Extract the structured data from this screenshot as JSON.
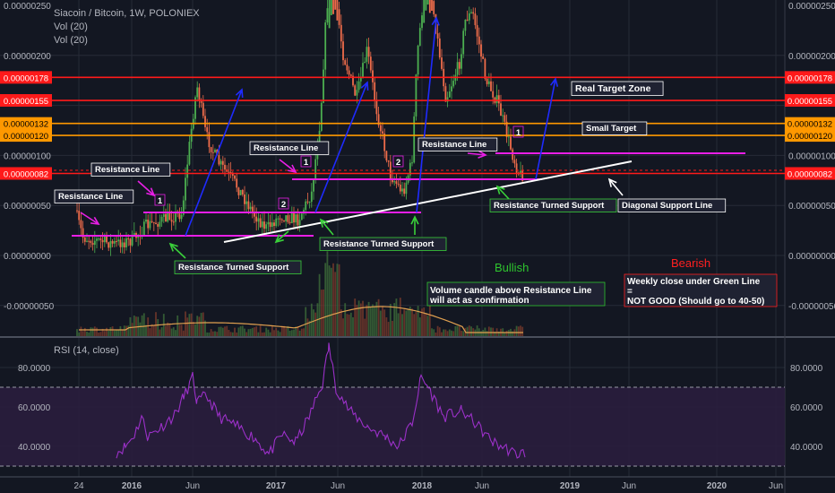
{
  "header": {
    "symbol": "Siacoin / Bitcoin, 1W, POLONIEX",
    "vol1": "Vol (20)",
    "vol2": "Vol (20)",
    "rsi_label": "RSI (14, close)"
  },
  "colors": {
    "background": "#131722",
    "grid": "#262b37",
    "up": "#4caf50",
    "down": "#ef6c4a",
    "red_line": "#ff1a1a",
    "orange_line": "#ff9800",
    "magenta": "#e91ee6",
    "white_line": "#ffffff",
    "blue_arrow": "#1f2bff",
    "green_arrow": "#3ad03a",
    "rsi_line": "#9b30c8",
    "rsi_band": "#2a1d3d"
  },
  "chart_data": [
    {
      "type": "candlestick",
      "title": "Siacoin / Bitcoin, 1W, POLONIEX",
      "ylim": [
        -8.5e-07,
        2.5e-06
      ],
      "y_ticks": [
        "0.00000250",
        "0.00000200",
        "0.00000100",
        "0.00000050",
        "0.00000000",
        "-0.00000050"
      ],
      "x_ticks": [
        "24",
        "2016",
        "Jun",
        "2017",
        "Jun",
        "2018",
        "Jun",
        "2019",
        "Jun",
        "2020",
        "Jun"
      ],
      "price_levels": [
        {
          "value": 1.78e-06,
          "label": "0.00000178",
          "color": "#ff1a1a"
        },
        {
          "value": 1.55e-06,
          "label": "0.00000155",
          "color": "#ff1a1a"
        },
        {
          "value": 1.32e-06,
          "label": "0.00000132",
          "color": "#ff9800"
        },
        {
          "value": 1.2e-06,
          "label": "0.00000120",
          "color": "#ff9800"
        },
        {
          "value": 8.2e-07,
          "label": "0.00000082",
          "color": "#ff1a1a"
        }
      ],
      "annotations": [
        "Resistance Line",
        "Resistance Line",
        "Resistance Line",
        "Resistance Line",
        "Resistance Line",
        "Resistance Turned Support",
        "Resistance Turned Support",
        "Resistance Turned Support",
        "Real Target Zone",
        "Small Target",
        "Diagonal Support Line",
        "Bullish",
        "Bearish",
        "Volume candle above Resistance Line will act as confirmation",
        "Weekly close under Green Line = NOT GOOD (Should go to 40-50)",
        "1",
        "2",
        "1",
        "2",
        "1",
        "1"
      ],
      "legend": [
        "Vol (20)",
        "Vol (20)"
      ]
    },
    {
      "type": "line",
      "title": "RSI (14, close)",
      "ylim": [
        27,
        100
      ],
      "y_ticks": [
        "80.0000",
        "60.0000",
        "40.0000"
      ],
      "bands": [
        30,
        70
      ]
    }
  ],
  "annotations": {
    "resistance_line": "Resistance Line",
    "resistance_turned_support": "Resistance Turned Support",
    "real_target_zone": "Real Target Zone",
    "small_target": "Small Target",
    "diagonal_support": "Diagonal Support Line",
    "bullish": "Bullish",
    "bearish": "Bearish",
    "volume_note_1": "Volume candle above Resistance Line",
    "volume_note_2": "will act as confirmation",
    "weekly_1": "Weekly close under Green Line",
    "weekly_2": "=",
    "weekly_3": "NOT GOOD (Should go to 40-50)",
    "n1": "1",
    "n2": "2"
  }
}
